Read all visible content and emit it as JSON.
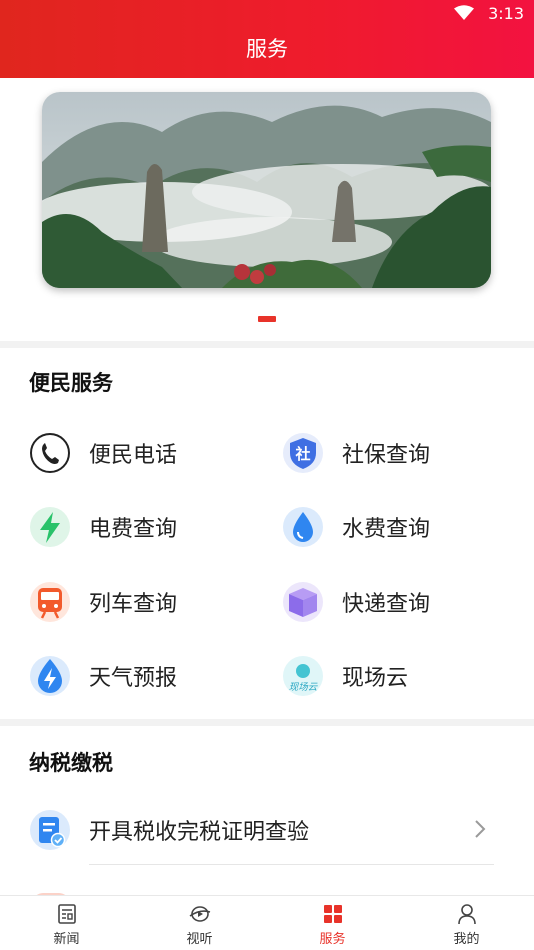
{
  "status_bar": {
    "time": "3:13"
  },
  "header": {
    "title": "服务"
  },
  "banner": {
    "pager_count": 1,
    "active_index": 0
  },
  "convenience": {
    "title": "便民服务",
    "items": [
      {
        "label": "便民电话",
        "icon": "phone-icon"
      },
      {
        "label": "社保查询",
        "icon": "social-security-icon",
        "icon_text": "社"
      },
      {
        "label": "电费查询",
        "icon": "lightning-icon"
      },
      {
        "label": "水费查询",
        "icon": "water-drop-icon"
      },
      {
        "label": "列车查询",
        "icon": "train-icon"
      },
      {
        "label": "快递查询",
        "icon": "package-icon"
      },
      {
        "label": "天气预报",
        "icon": "weather-icon"
      },
      {
        "label": "现场云",
        "icon": "xianchangyun-logo",
        "icon_text": "现场云"
      }
    ]
  },
  "tax": {
    "title": "纳税缴税",
    "items": [
      {
        "label": "开具税收完税证明查验",
        "icon": "tax-certificate-icon"
      }
    ]
  },
  "bottom_nav": {
    "items": [
      {
        "label": "新闻",
        "icon": "news-icon",
        "active": false
      },
      {
        "label": "视听",
        "icon": "video-icon",
        "active": false
      },
      {
        "label": "服务",
        "icon": "service-grid-icon",
        "active": true
      },
      {
        "label": "我的",
        "icon": "profile-icon",
        "active": false
      }
    ]
  },
  "colors": {
    "brand_red": "#e8332a",
    "header_start": "#e0261e",
    "header_end": "#f31240"
  }
}
